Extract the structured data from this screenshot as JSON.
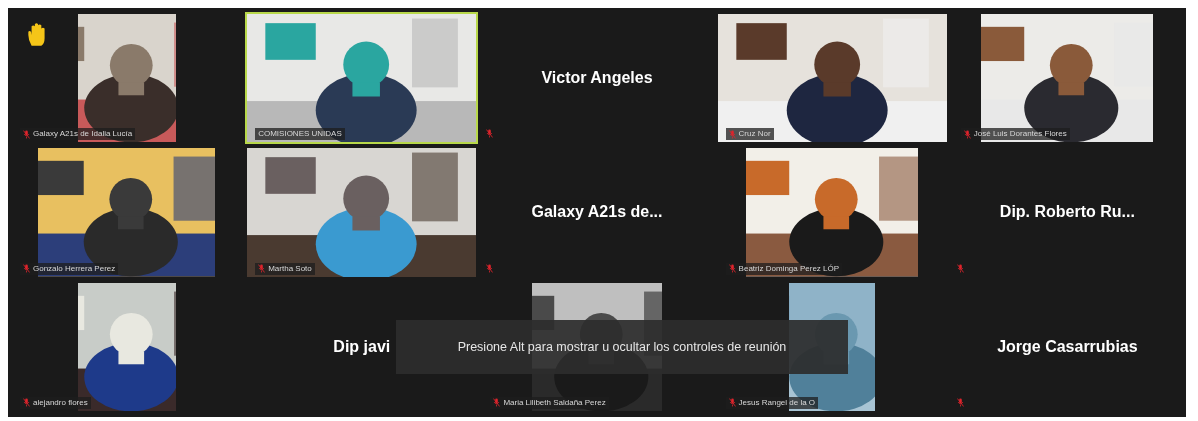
{
  "tiles": [
    {
      "kind": "video",
      "name": "Galaxy A21s de Idalia Lucía",
      "muted": true,
      "hand_raised": true,
      "selected": false
    },
    {
      "kind": "video",
      "name": "COMISIONES UNIDAS",
      "muted": false,
      "hand_raised": false,
      "selected": true
    },
    {
      "kind": "name",
      "name": "Victor Angeles",
      "muted": true,
      "hand_raised": false,
      "selected": false
    },
    {
      "kind": "video",
      "name": "Cruz Nor",
      "muted": true,
      "hand_raised": false,
      "selected": false
    },
    {
      "kind": "video",
      "name": "José Luis Dorantes Flores",
      "muted": true,
      "hand_raised": false,
      "selected": false
    },
    {
      "kind": "video",
      "name": "Gonzalo Herrera Perez",
      "muted": true,
      "hand_raised": false,
      "selected": false
    },
    {
      "kind": "video",
      "name": "Martha Soto",
      "muted": true,
      "hand_raised": false,
      "selected": false
    },
    {
      "kind": "name",
      "name": "Galaxy A21s de...",
      "muted": true,
      "hand_raised": false,
      "selected": false
    },
    {
      "kind": "video",
      "name": "Beatriz Dominga Perez LÓP",
      "muted": true,
      "hand_raised": false,
      "selected": false
    },
    {
      "kind": "name",
      "name": "Dip. Roberto Ru...",
      "muted": true,
      "hand_raised": false,
      "selected": false
    },
    {
      "kind": "video",
      "name": "alejandro flores",
      "muted": true,
      "hand_raised": false,
      "selected": false
    },
    {
      "kind": "name",
      "name": "Dip javi",
      "muted": false,
      "hand_raised": false,
      "selected": false
    },
    {
      "kind": "video",
      "name": "Maria Lilibeth Saldaña Perez",
      "muted": true,
      "hand_raised": false,
      "selected": false
    },
    {
      "kind": "video",
      "name": "Jesus Rangel de la O",
      "muted": true,
      "hand_raised": false,
      "selected": false
    },
    {
      "kind": "name",
      "name": "Jorge Casarrubias",
      "muted": true,
      "hand_raised": false,
      "selected": false
    }
  ],
  "toast": {
    "text": "Presione Alt para mostrar u ocultar los controles de reunión"
  }
}
